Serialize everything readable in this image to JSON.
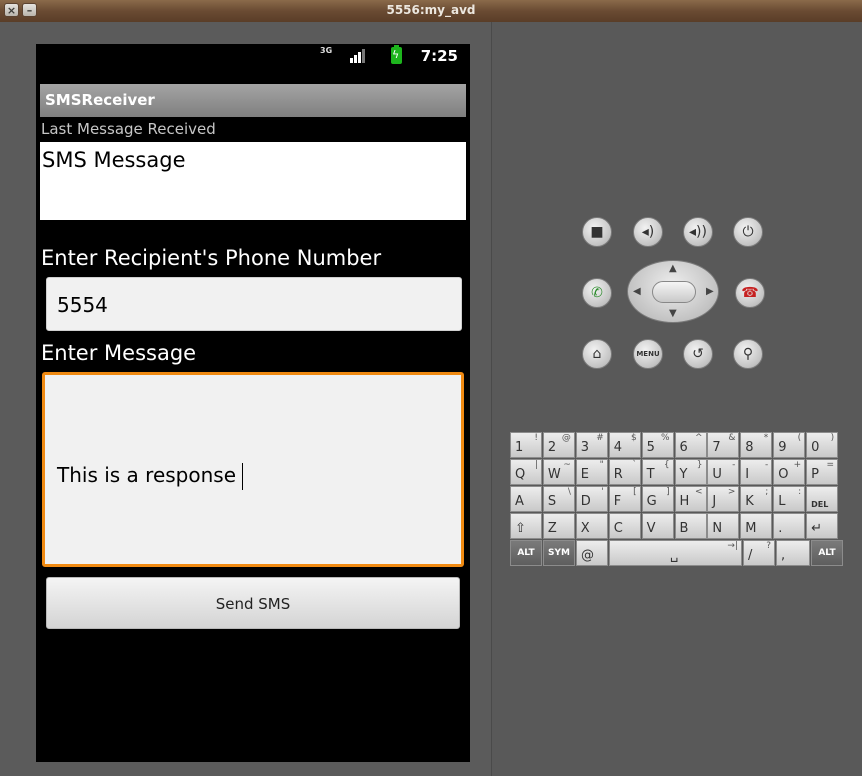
{
  "window": {
    "title": "5556:my_avd"
  },
  "status_bar": {
    "network": "3G",
    "time": "7:25"
  },
  "app": {
    "title": "SMSReceiver",
    "last_message_label": "Last Message Received",
    "last_message_value": "SMS Message",
    "phone_label": "Enter Recipient's Phone Number",
    "phone_value": "5554",
    "message_label": "Enter Message",
    "message_value": "This is a response",
    "send_button": "Send SMS"
  },
  "keyboard": {
    "row1": [
      {
        "main": "1",
        "alt": "!"
      },
      {
        "main": "2",
        "alt": "@"
      },
      {
        "main": "3",
        "alt": "#"
      },
      {
        "main": "4",
        "alt": "$"
      },
      {
        "main": "5",
        "alt": "%"
      },
      {
        "main": "6",
        "alt": "^"
      },
      {
        "main": "7",
        "alt": "&"
      },
      {
        "main": "8",
        "alt": "*"
      },
      {
        "main": "9",
        "alt": "("
      },
      {
        "main": "0",
        "alt": ")"
      }
    ],
    "row2": [
      {
        "main": "Q",
        "alt": "|"
      },
      {
        "main": "W",
        "alt": "~"
      },
      {
        "main": "E",
        "alt": "\""
      },
      {
        "main": "R",
        "alt": "`"
      },
      {
        "main": "T",
        "alt": "{"
      },
      {
        "main": "Y",
        "alt": "}"
      },
      {
        "main": "U",
        "alt": "-"
      },
      {
        "main": "I",
        "alt": "-"
      },
      {
        "main": "O",
        "alt": "+"
      },
      {
        "main": "P",
        "alt": "="
      }
    ],
    "row3": [
      {
        "main": "A",
        "alt": ""
      },
      {
        "main": "S",
        "alt": "\\"
      },
      {
        "main": "D",
        "alt": "'"
      },
      {
        "main": "F",
        "alt": "["
      },
      {
        "main": "G",
        "alt": "]"
      },
      {
        "main": "H",
        "alt": "<"
      },
      {
        "main": "J",
        "alt": ">"
      },
      {
        "main": "K",
        "alt": ";"
      },
      {
        "main": "L",
        "alt": ":"
      },
      {
        "main": "DEL",
        "alt": ""
      }
    ],
    "row4": [
      {
        "main": "⇧",
        "alt": ""
      },
      {
        "main": "Z",
        "alt": ""
      },
      {
        "main": "X",
        "alt": ""
      },
      {
        "main": "C",
        "alt": ""
      },
      {
        "main": "V",
        "alt": ""
      },
      {
        "main": "B",
        "alt": ""
      },
      {
        "main": "N",
        "alt": ""
      },
      {
        "main": "M",
        "alt": ""
      },
      {
        "main": ".",
        "alt": ""
      },
      {
        "main": "↵",
        "alt": ""
      }
    ],
    "row5": [
      {
        "main": "ALT",
        "alt": ""
      },
      {
        "main": "SYM",
        "alt": ""
      },
      {
        "main": "@",
        "alt": ""
      },
      {
        "main": "␣",
        "alt": "→|"
      },
      {
        "main": "/",
        "alt": "?"
      },
      {
        "main": ",",
        "alt": ""
      },
      {
        "main": "ALT",
        "alt": ""
      }
    ]
  },
  "controls": {
    "menu_label": "MENU"
  }
}
